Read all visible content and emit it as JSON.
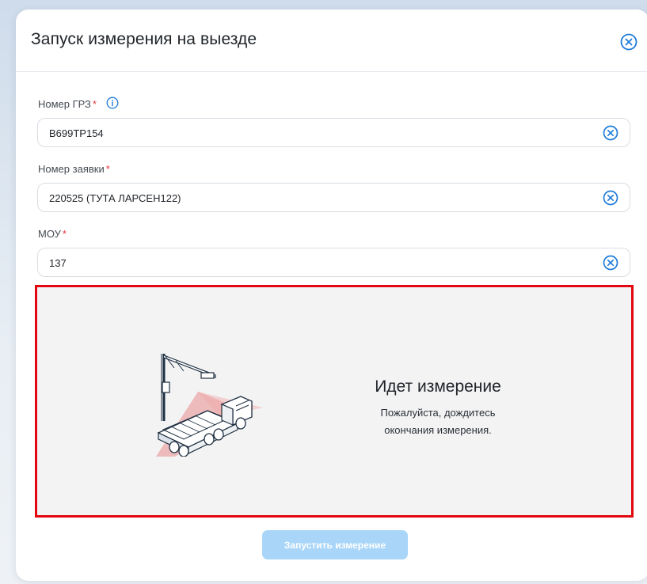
{
  "modal": {
    "title": "Запуск измерения на выезде",
    "close_icon": "close-circle-icon"
  },
  "form": {
    "plate": {
      "label": "Номер ГРЗ",
      "required_mark": "*",
      "info_icon": "info-icon",
      "value": "В699ТР154",
      "clear_icon": "clear-circle-icon"
    },
    "request": {
      "label": "Номер заявки",
      "required_mark": "*",
      "value": "220525 (ТУТА ЛАРСЕН122)",
      "clear_icon": "clear-circle-icon"
    },
    "mou": {
      "label": "МОУ",
      "required_mark": "*",
      "value": "137",
      "clear_icon": "clear-circle-icon"
    }
  },
  "measurement": {
    "title": "Идет измерение",
    "text": "Пожалуйста, дождитесь\nокончания измерения.",
    "illustration": "truck-scanner-illustration",
    "highlight_color": "#e3060f"
  },
  "actions": {
    "start_label": "Запустить измерение"
  },
  "colors": {
    "accent": "#1e7bd9",
    "required": "#e5373e",
    "button_disabled": "#a9d6f8",
    "panel_bg": "#f3f3f4"
  }
}
